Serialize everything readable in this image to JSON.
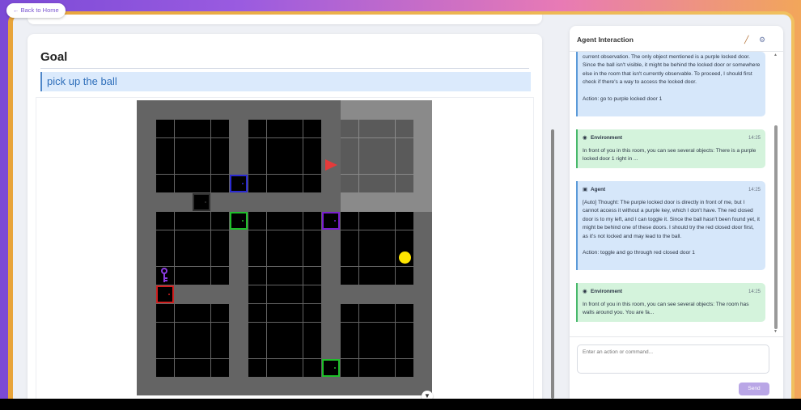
{
  "nav": {
    "back_label": "← Back to Home"
  },
  "goal": {
    "heading": "Goal",
    "mission": "pick up the ball"
  },
  "panel": {
    "title": "Agent Interaction",
    "messages": [
      {
        "role": "agent",
        "sender": "",
        "time": "",
        "text": "current observation. The only object mentioned is a purple locked door. Since the ball isn't visible, it might be behind the locked door or somewhere else in the room that isn't currently observable. To proceed, I should first check if there's a way to access the locked door.\n\nAction: go to purple locked door 1"
      },
      {
        "role": "env",
        "sender": "Environment",
        "time": "14:25",
        "text": "In front of you in this room, you can see several objects: There is a purple locked door 1 right in ..."
      },
      {
        "role": "agent",
        "sender": "Agent",
        "time": "14:25",
        "text": "[Auto] Thought: The purple locked door is directly in front of me, but I cannot access it without a purple key, which I don't have. The red closed door is to my left, and I can toggle it. Since the ball hasn't been found yet, it might be behind one of these doors. I should try the red closed door first, as it's not locked and may lead to the ball.\n\nAction: toggle and go through red closed door 1"
      },
      {
        "role": "env",
        "sender": "Environment",
        "time": "14:25",
        "text": "In front of you in this room, you can see several objects: The room has walls around you. You are fa..."
      }
    ],
    "input_placeholder": "Enter an action or command...",
    "send_label": "Send"
  },
  "colors": {
    "door_blue": "#2a2ad0",
    "door_green": "#1fbf2a",
    "door_purple": "#7a1fd0",
    "door_red": "#d01f1f",
    "door_dark": "#303030",
    "agent_arrow": "#e53a3a",
    "ball": "#ffe600",
    "key": "#8a3ae0"
  },
  "grid_objects": [
    {
      "type": "door",
      "color": "blue",
      "state": "closed"
    },
    {
      "type": "door",
      "color": "dark",
      "state": "closed"
    },
    {
      "type": "door",
      "color": "green",
      "state": "closed"
    },
    {
      "type": "door",
      "color": "purple",
      "state": "locked"
    },
    {
      "type": "door",
      "color": "red",
      "state": "closed"
    },
    {
      "type": "door",
      "color": "green",
      "state": "closed"
    },
    {
      "type": "key",
      "color": "purple"
    },
    {
      "type": "ball",
      "color": "yellow"
    },
    {
      "type": "agent",
      "facing": "right"
    }
  ]
}
